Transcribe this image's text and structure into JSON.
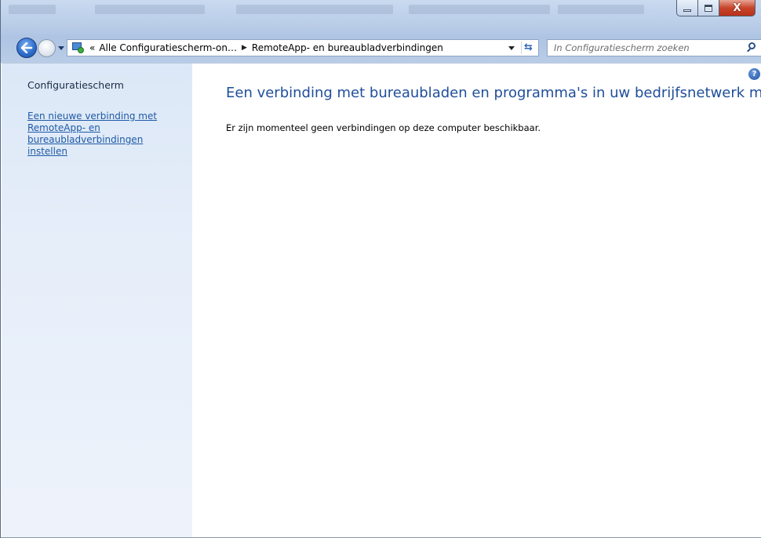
{
  "window": {
    "controls": {
      "minimize_icon": "minimize-icon",
      "maximize_icon": "maximize-icon",
      "close_glyph": "X"
    }
  },
  "nav": {
    "back_icon": "back-arrow-icon",
    "forward_icon": "forward-arrow-icon"
  },
  "address": {
    "overflow_glyph": "«",
    "crumbs": [
      "Alle Configuratiescherm-on…",
      "RemoteApp- en bureaubladverbindingen"
    ],
    "separator_glyph": "▶",
    "refresh_glyph": "⇆"
  },
  "search": {
    "placeholder": "In Configuratiescherm zoeken"
  },
  "sidebar": {
    "title": "Configuratiescherm",
    "link": "Een nieuwe verbinding met RemoteApp- en bureaubladverbindingen instellen"
  },
  "main": {
    "help_glyph": "?",
    "title": "Een verbinding met bureaubladen en programma's in uw bedrijfsnetwerk maken",
    "message": "Er zijn momenteel geen verbindingen op deze computer beschikbaar."
  }
}
